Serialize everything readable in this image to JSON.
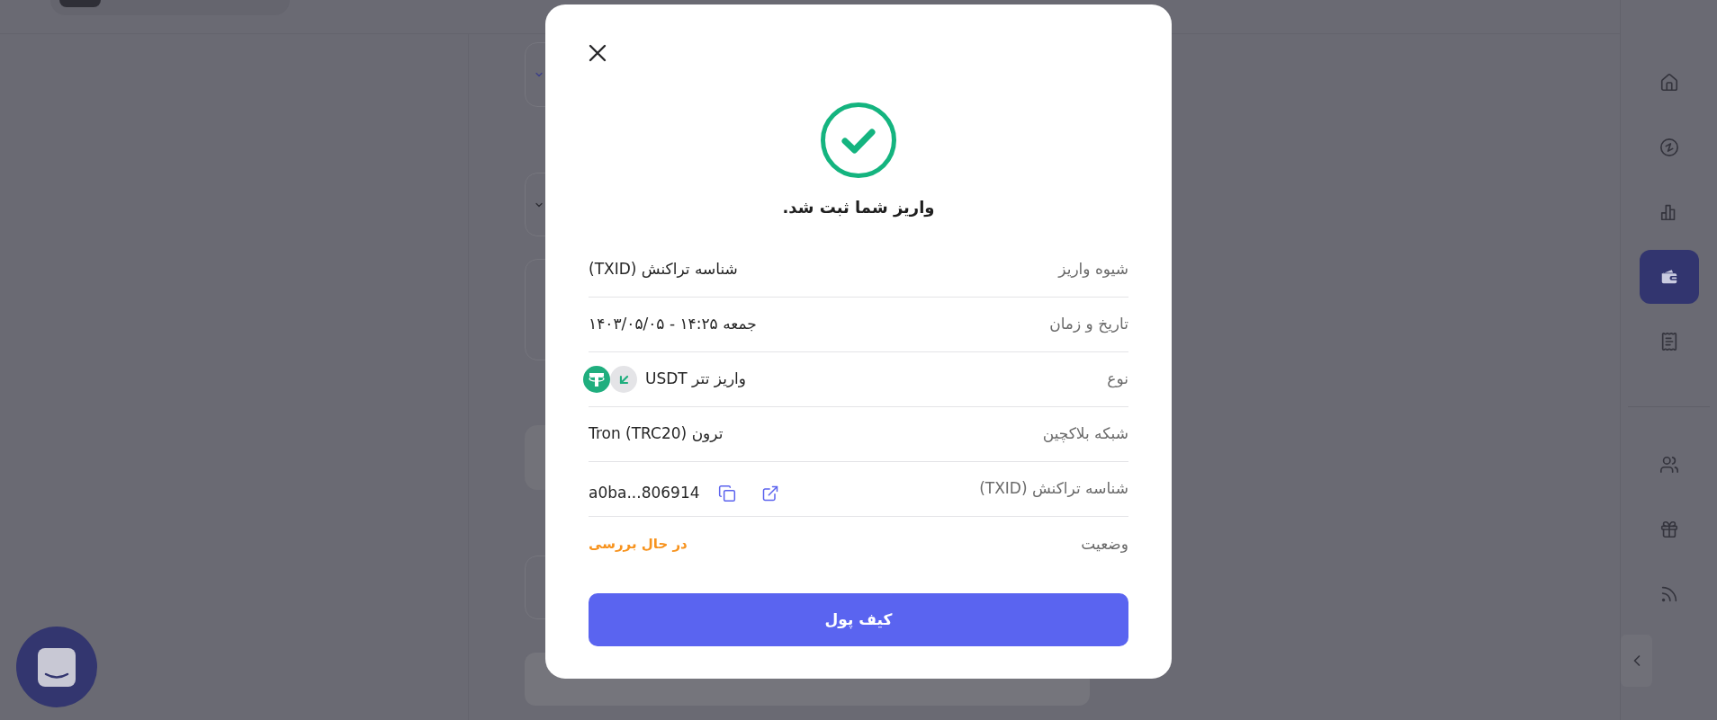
{
  "modal": {
    "title": "واریز شما ثبت شد.",
    "details": [
      {
        "kind": "text",
        "label": "شیوه واریز",
        "value": "شناسه تراکنش (TXID)"
      },
      {
        "kind": "text",
        "label": "تاریخ و زمان",
        "value": "جمعه ۱۴:۲۵ - ۱۴۰۳/۰۵/۰۵"
      },
      {
        "kind": "asset",
        "label": "نوع",
        "value": "واریز تتر USDT"
      },
      {
        "kind": "text",
        "label": "شبکه بلاکچین",
        "value": "ترون (TRC20) Tron"
      },
      {
        "kind": "hash",
        "label": "شناسه تراکنش (TXID)",
        "value": "a0ba...806914"
      },
      {
        "kind": "status",
        "label": "وضعیت",
        "value": "در حال بررسی"
      }
    ],
    "button": {
      "label": "کیف پول"
    }
  },
  "sidebar": {
    "groups": [
      {
        "items": [
          {
            "selected": false
          },
          {
            "selected": false
          },
          {
            "selected": false
          },
          {
            "selected": true
          },
          {
            "selected": false
          }
        ]
      },
      {
        "items": [
          {
            "selected": false
          },
          {
            "selected": false
          },
          {
            "selected": false
          }
        ]
      }
    ]
  }
}
